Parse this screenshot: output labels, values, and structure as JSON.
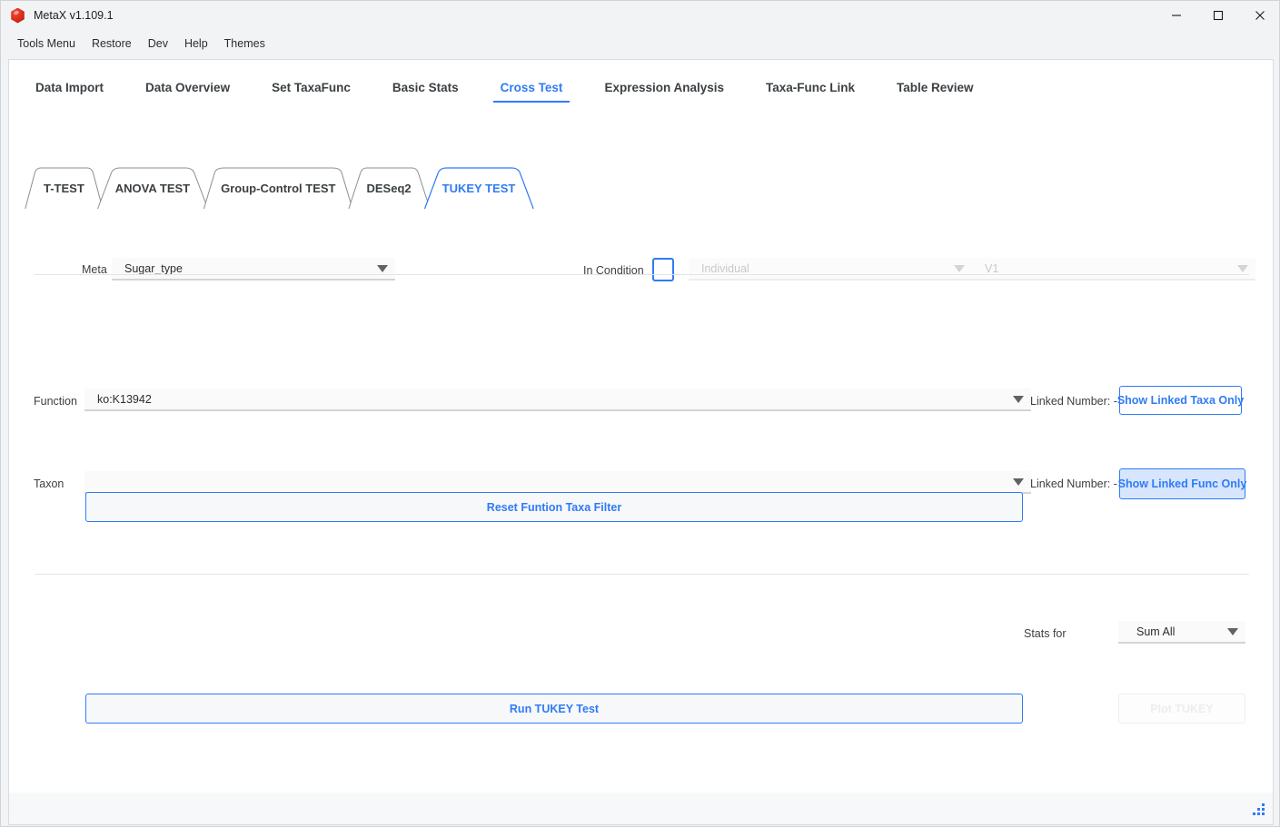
{
  "window": {
    "title": "MetaX v1.109.1",
    "app_icon": "hexagon-app-icon",
    "controls": {
      "minimize": "minimize-icon",
      "maximize": "maximize-icon",
      "close": "close-icon"
    }
  },
  "menu_bar": {
    "items": [
      {
        "label": "Tools Menu"
      },
      {
        "label": "Restore"
      },
      {
        "label": "Dev"
      },
      {
        "label": "Help"
      },
      {
        "label": "Themes"
      }
    ]
  },
  "main_tabs": {
    "active": "Cross Test",
    "items": [
      {
        "label": "Data Import",
        "active": false
      },
      {
        "label": "Data Overview",
        "active": false
      },
      {
        "label": "Set TaxaFunc",
        "active": false
      },
      {
        "label": "Basic Stats",
        "active": false
      },
      {
        "label": "Cross Test",
        "active": true
      },
      {
        "label": "Expression Analysis",
        "active": false
      },
      {
        "label": "Taxa-Func Link",
        "active": false
      },
      {
        "label": "Table Review",
        "active": false
      }
    ]
  },
  "sub_tabs": {
    "active": "TUKEY TEST",
    "items": [
      {
        "label": "T-TEST",
        "active": false
      },
      {
        "label": "ANOVA TEST",
        "active": false
      },
      {
        "label": "Group-Control TEST",
        "active": false
      },
      {
        "label": "DESeq2",
        "active": false
      },
      {
        "label": "TUKEY TEST",
        "active": true
      }
    ]
  },
  "form": {
    "meta": {
      "label": "Meta",
      "value": "Sugar_type",
      "arrow_icon": "chevron-down-icon"
    },
    "in_condition": {
      "label": "In Condition",
      "checked": false,
      "condition_select": {
        "value": "Individual",
        "disabled": true,
        "arrow_icon": "chevron-down-icon"
      },
      "condition_value_select": {
        "value": "V1",
        "disabled": true,
        "arrow_icon": "chevron-down-icon"
      }
    },
    "function_row": {
      "label": "Function",
      "value": "ko:K13942",
      "arrow_icon": "chevron-down-icon",
      "linked_number_label": "Linked Number: -",
      "button_label": "Show Linked Taxa Only"
    },
    "taxon_row": {
      "label": "Taxon",
      "value": "",
      "arrow_icon": "chevron-down-icon",
      "linked_number_label": "Linked Number: -",
      "button_label": "Show Linked Func Only"
    },
    "reset_button": {
      "label": "Reset Funtion  Taxa Filter"
    },
    "stats_for": {
      "label": "Stats for",
      "value": "Sum All",
      "arrow_icon": "chevron-down-icon"
    },
    "run_button": {
      "label": "Run TUKEY Test"
    },
    "plot_button": {
      "label": "Plot TUKEY",
      "disabled": true
    }
  },
  "colors": {
    "accent": "#2f7bf6",
    "text": "#3c4043",
    "window_bg": "#f2f3f5",
    "panel_bg": "#ffffff",
    "separator": "#e2e4e7",
    "disabled_text": "#c6c9cc"
  }
}
